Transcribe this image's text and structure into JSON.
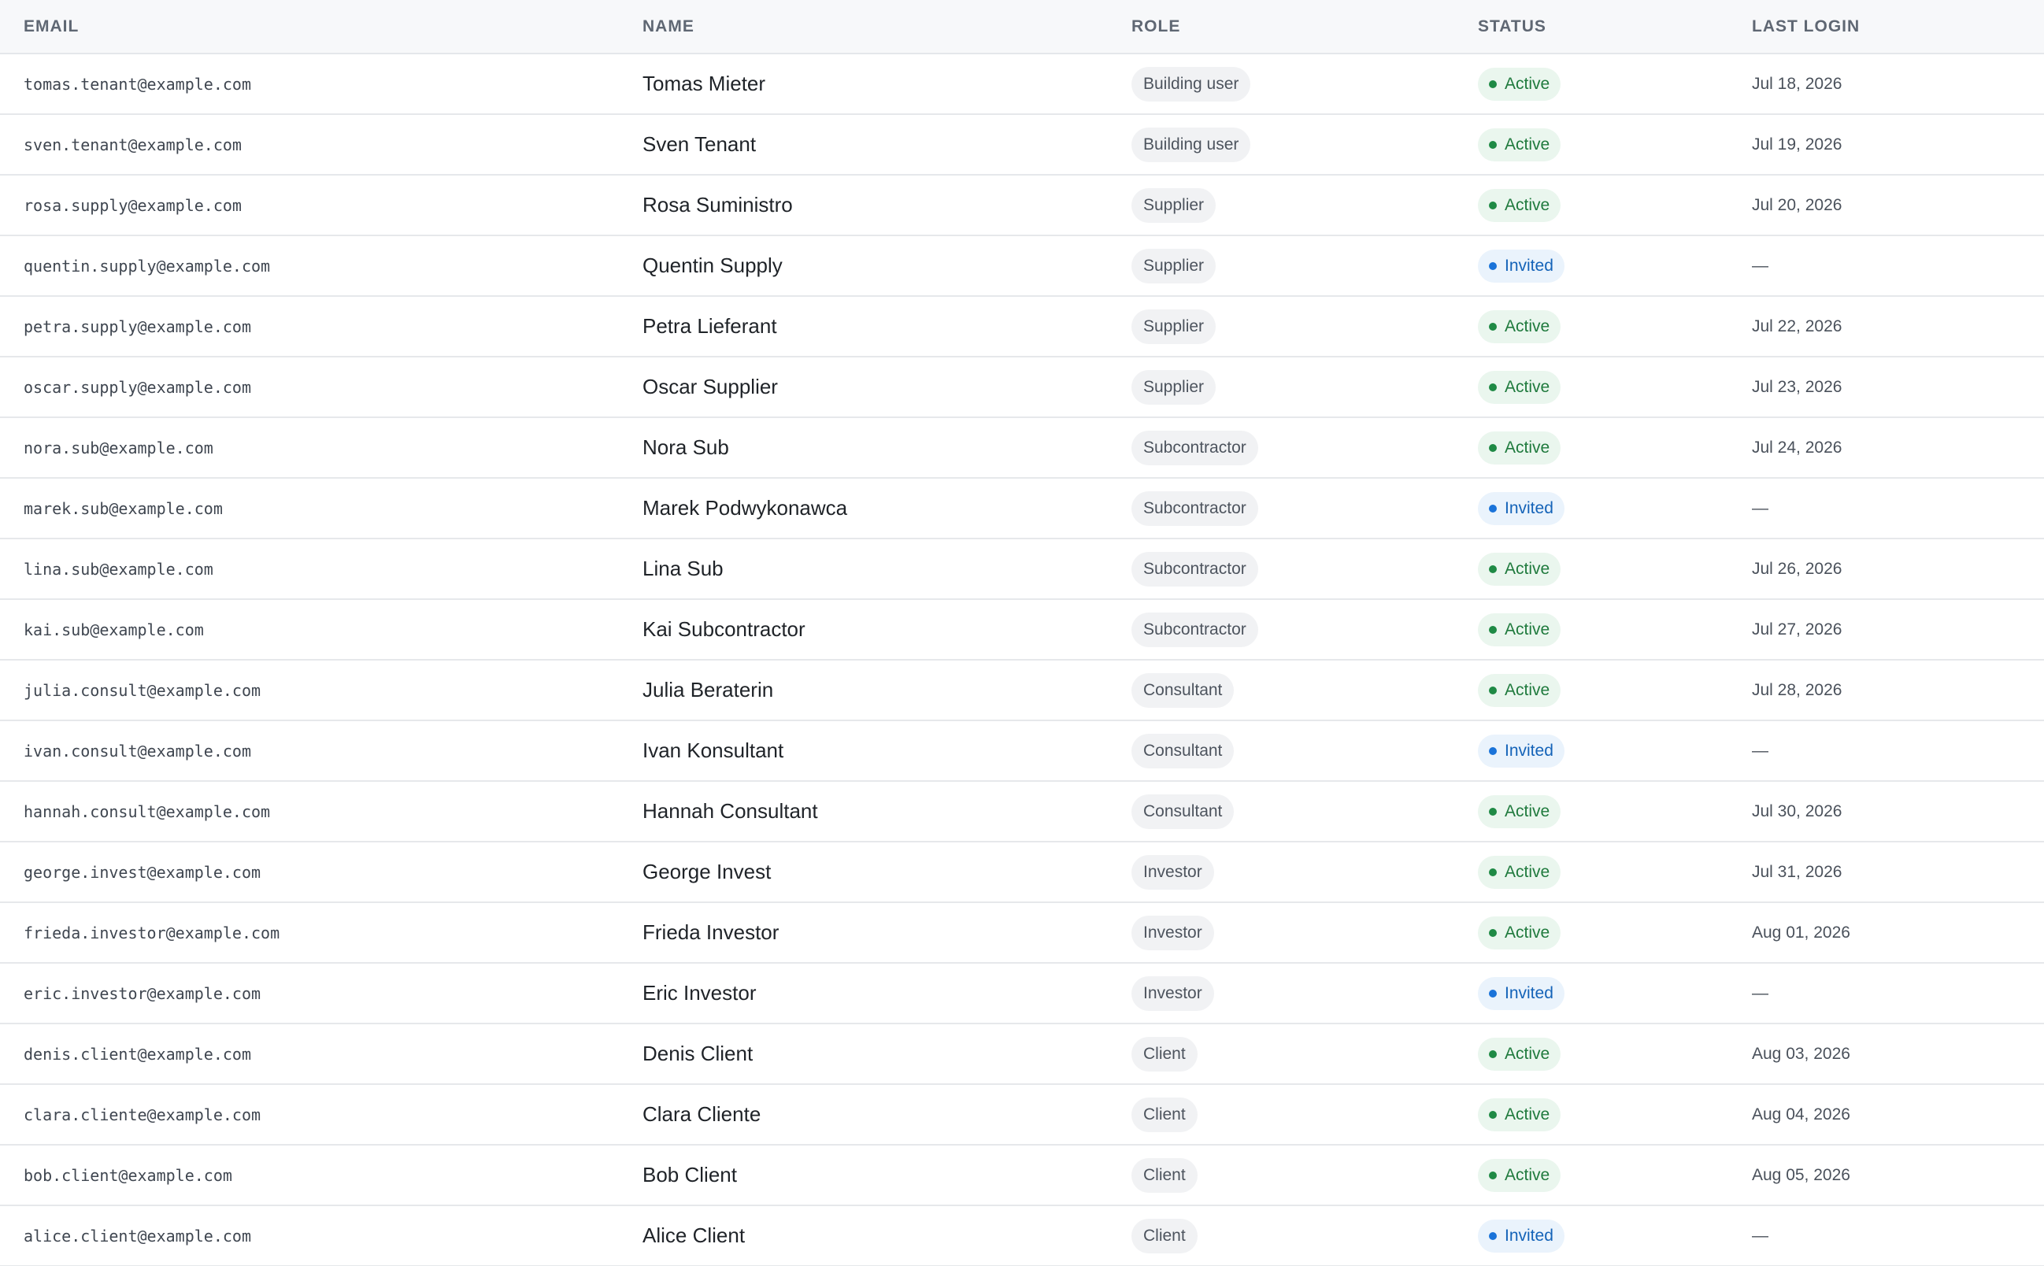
{
  "columns": {
    "email": "EMAIL",
    "name": "NAME",
    "role": "ROLE",
    "status": "STATUS",
    "last_login": "LAST LOGIN"
  },
  "colors": {
    "active": "#1f7a3d",
    "invited": "#1463b8"
  },
  "rows": [
    {
      "email": "tomas.tenant@example.com",
      "name": "Tomas Mieter",
      "role": "Building user",
      "status": "Active",
      "last_login": "Jul 18, 2026"
    },
    {
      "email": "sven.tenant@example.com",
      "name": "Sven Tenant",
      "role": "Building user",
      "status": "Active",
      "last_login": "Jul 19, 2026"
    },
    {
      "email": "rosa.supply@example.com",
      "name": "Rosa Suministro",
      "role": "Supplier",
      "status": "Active",
      "last_login": "Jul 20, 2026"
    },
    {
      "email": "quentin.supply@example.com",
      "name": "Quentin Supply",
      "role": "Supplier",
      "status": "Invited",
      "last_login": "—"
    },
    {
      "email": "petra.supply@example.com",
      "name": "Petra Lieferant",
      "role": "Supplier",
      "status": "Active",
      "last_login": "Jul 22, 2026"
    },
    {
      "email": "oscar.supply@example.com",
      "name": "Oscar Supplier",
      "role": "Supplier",
      "status": "Active",
      "last_login": "Jul 23, 2026"
    },
    {
      "email": "nora.sub@example.com",
      "name": "Nora Sub",
      "role": "Subcontractor",
      "status": "Active",
      "last_login": "Jul 24, 2026"
    },
    {
      "email": "marek.sub@example.com",
      "name": "Marek Podwykonawca",
      "role": "Subcontractor",
      "status": "Invited",
      "last_login": "—"
    },
    {
      "email": "lina.sub@example.com",
      "name": "Lina Sub",
      "role": "Subcontractor",
      "status": "Active",
      "last_login": "Jul 26, 2026"
    },
    {
      "email": "kai.sub@example.com",
      "name": "Kai Subcontractor",
      "role": "Subcontractor",
      "status": "Active",
      "last_login": "Jul 27, 2026"
    },
    {
      "email": "julia.consult@example.com",
      "name": "Julia Beraterin",
      "role": "Consultant",
      "status": "Active",
      "last_login": "Jul 28, 2026"
    },
    {
      "email": "ivan.consult@example.com",
      "name": "Ivan Konsultant",
      "role": "Consultant",
      "status": "Invited",
      "last_login": "—"
    },
    {
      "email": "hannah.consult@example.com",
      "name": "Hannah Consultant",
      "role": "Consultant",
      "status": "Active",
      "last_login": "Jul 30, 2026"
    },
    {
      "email": "george.invest@example.com",
      "name": "George Invest",
      "role": "Investor",
      "status": "Active",
      "last_login": "Jul 31, 2026"
    },
    {
      "email": "frieda.investor@example.com",
      "name": "Frieda Investor",
      "role": "Investor",
      "status": "Active",
      "last_login": "Aug 01, 2026"
    },
    {
      "email": "eric.investor@example.com",
      "name": "Eric Investor",
      "role": "Investor",
      "status": "Invited",
      "last_login": "—"
    },
    {
      "email": "denis.client@example.com",
      "name": "Denis Client",
      "role": "Client",
      "status": "Active",
      "last_login": "Aug 03, 2026"
    },
    {
      "email": "clara.cliente@example.com",
      "name": "Clara Cliente",
      "role": "Client",
      "status": "Active",
      "last_login": "Aug 04, 2026"
    },
    {
      "email": "bob.client@example.com",
      "name": "Bob Client",
      "role": "Client",
      "status": "Active",
      "last_login": "Aug 05, 2026"
    },
    {
      "email": "alice.client@example.com",
      "name": "Alice Client",
      "role": "Client",
      "status": "Invited",
      "last_login": "—"
    }
  ]
}
